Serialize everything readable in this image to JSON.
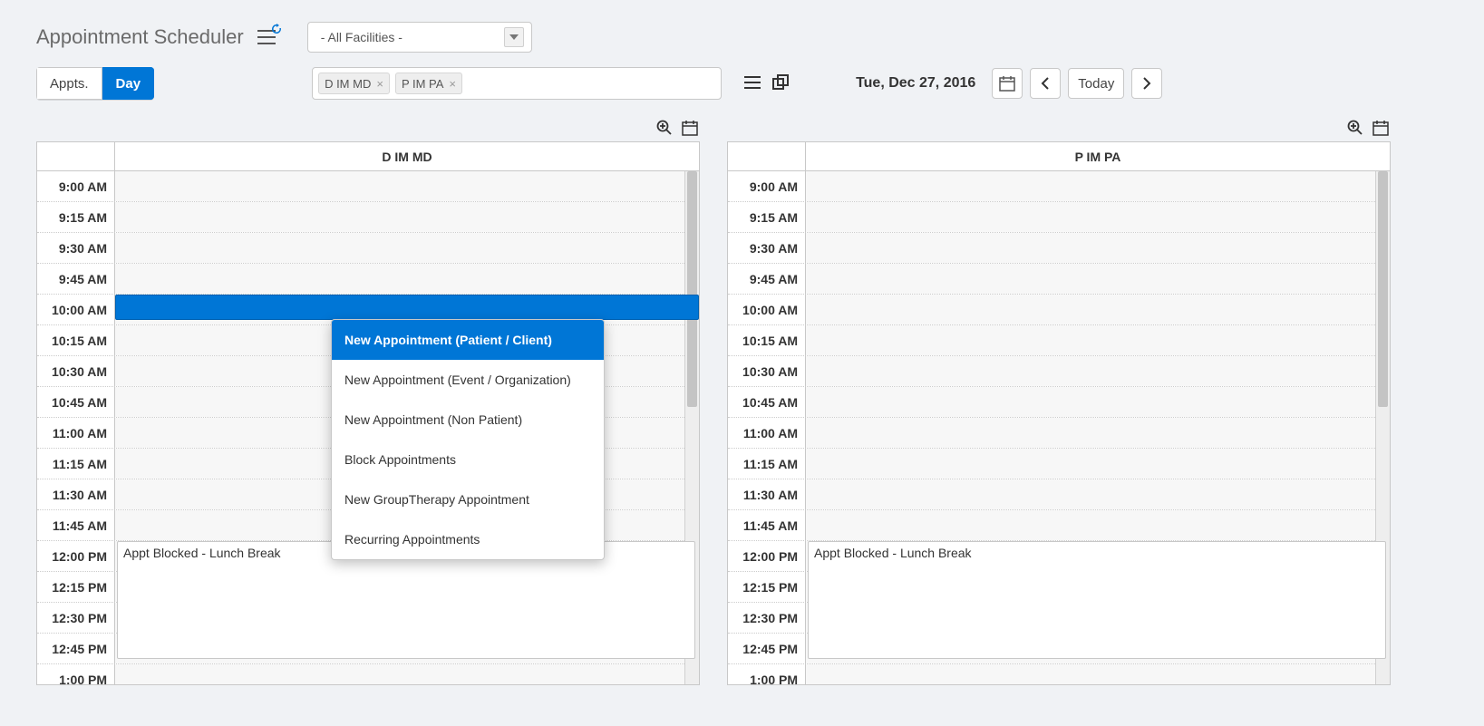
{
  "header": {
    "title": "Appointment Scheduler",
    "facility_selected": "- All Facilities -"
  },
  "view_toggle": {
    "appts": "Appts.",
    "day": "Day"
  },
  "provider_chips": [
    {
      "label": "D IM MD"
    },
    {
      "label": "P IM PA"
    }
  ],
  "date": {
    "label": "Tue, Dec 27, 2016",
    "today_label": "Today"
  },
  "time_slots": [
    "9:00 AM",
    "9:15 AM",
    "9:30 AM",
    "9:45 AM",
    "10:00 AM",
    "10:15 AM",
    "10:30 AM",
    "10:45 AM",
    "11:00 AM",
    "11:15 AM",
    "11:30 AM",
    "11:45 AM",
    "12:00 PM",
    "12:15 PM",
    "12:30 PM",
    "12:45 PM",
    "1:00 PM"
  ],
  "columns": {
    "left": {
      "provider": "D IM MD",
      "blocked_label": "Appt Blocked - Lunch Break"
    },
    "right": {
      "provider": "P IM PA",
      "blocked_label": "Appt Blocked - Lunch Break"
    }
  },
  "context_menu": {
    "items": [
      "New Appointment (Patient / Client)",
      "New Appointment (Event / Organization)",
      "New Appointment (Non Patient)",
      "Block Appointments",
      "New GroupTherapy Appointment",
      "Recurring Appointments"
    ]
  }
}
